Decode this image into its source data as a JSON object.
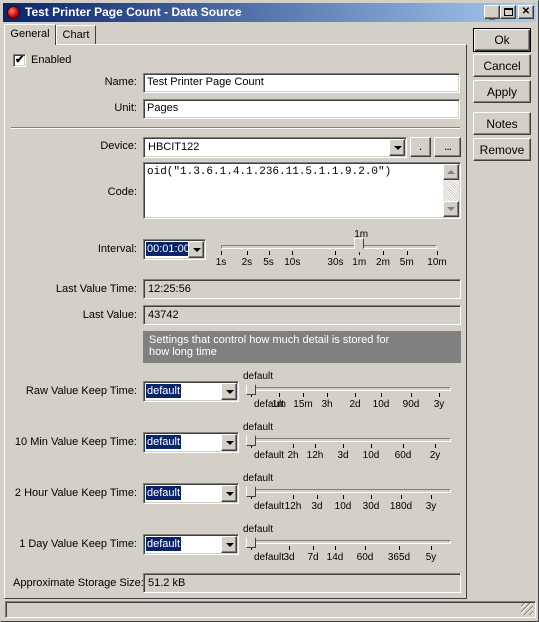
{
  "window": {
    "title": "Test Printer Page Count - Data Source"
  },
  "tabs": [
    {
      "label": "General"
    },
    {
      "label": "Chart"
    }
  ],
  "buttons": {
    "ok": "Ok",
    "cancel": "Cancel",
    "apply": "Apply",
    "notes": "Notes",
    "remove": "Remove"
  },
  "form": {
    "enabled_label": "Enabled",
    "enabled_checked": true,
    "name_label": "Name:",
    "name_value": "Test Printer Page Count",
    "unit_label": "Unit:",
    "unit_value": "Pages",
    "device_label": "Device:",
    "device_value": "HBCIT122",
    "device_btn1": ".",
    "device_btn2": "...",
    "code_label": "Code:",
    "code_value": "oid(\"1.3.6.1.4.1.236.11.5.1.1.9.2.0\")",
    "interval_label": "Interval:",
    "interval_value": "00:01:00",
    "interval_slider": {
      "current": "1m",
      "ticks": [
        "1s",
        "2s",
        "5s",
        "10s",
        "30s",
        "1m",
        "2m",
        "5m",
        "10m"
      ]
    },
    "last_value_time_label": "Last Value Time:",
    "last_value_time": "12:25:56",
    "last_value_label": "Last Value:",
    "last_value": "43742",
    "info_text": "Settings that control how much detail is stored for how long time",
    "keep": [
      {
        "label": "Raw Value Keep Time:",
        "value": "default",
        "current": "default",
        "ticks": [
          "default",
          "1m",
          "15m",
          "3h",
          "2d",
          "10d",
          "90d",
          "3y"
        ]
      },
      {
        "label": "10 Min Value Keep Time:",
        "value": "default",
        "current": "default",
        "ticks": [
          "default",
          "2h",
          "12h",
          "3d",
          "10d",
          "60d",
          "2y"
        ]
      },
      {
        "label": "2 Hour Value Keep Time:",
        "value": "default",
        "current": "default",
        "ticks": [
          "default",
          "12h",
          "3d",
          "10d",
          "30d",
          "180d",
          "3y"
        ]
      },
      {
        "label": "1 Day Value Keep Time:",
        "value": "default",
        "current": "default",
        "ticks": [
          "default",
          "3d",
          "7d",
          "14d",
          "60d",
          "365d",
          "5y"
        ]
      }
    ],
    "storage_label": "Approximate Storage Size:",
    "storage_value": "51.2 kB"
  },
  "icons": {
    "title": "app-red-ball-icon",
    "check": "checkmark-icon",
    "dropdown": "chevron-down-icon"
  }
}
